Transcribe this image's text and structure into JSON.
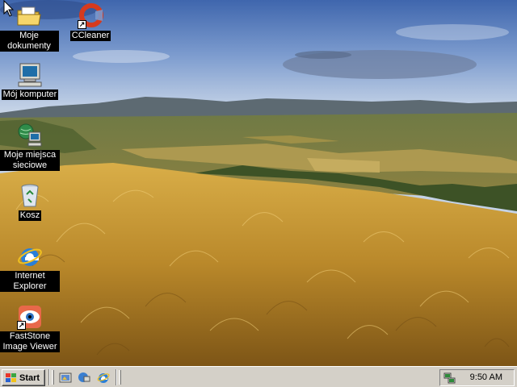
{
  "desktop": {
    "icons": [
      {
        "label": "Moje dokumenty",
        "icon": "my-documents-folder-icon",
        "shortcut": false
      },
      {
        "label": "CCleaner",
        "icon": "ccleaner-icon",
        "shortcut": true
      },
      {
        "label": "Mój komputer",
        "icon": "my-computer-icon",
        "shortcut": false
      },
      {
        "label": "Moje miejsca sieciowe",
        "icon": "network-places-icon",
        "shortcut": false
      },
      {
        "label": "Kosz",
        "icon": "recycle-bin-icon",
        "shortcut": false
      },
      {
        "label": "Internet Explorer",
        "icon": "internet-explorer-icon",
        "shortcut": false
      },
      {
        "label": "FastStone Image Viewer",
        "icon": "faststone-eye-icon",
        "shortcut": true
      }
    ]
  },
  "taskbar": {
    "start_label": "Start",
    "quick_launch": [
      "show-desktop-icon",
      "browser-network-icon",
      "internet-explorer-icon"
    ],
    "clock": "9:50 AM",
    "tray_icon": "network-connection-icon"
  },
  "colors": {
    "taskbar": "#d4d0c8",
    "label_background": "#000000",
    "label_text": "#ffffff"
  }
}
